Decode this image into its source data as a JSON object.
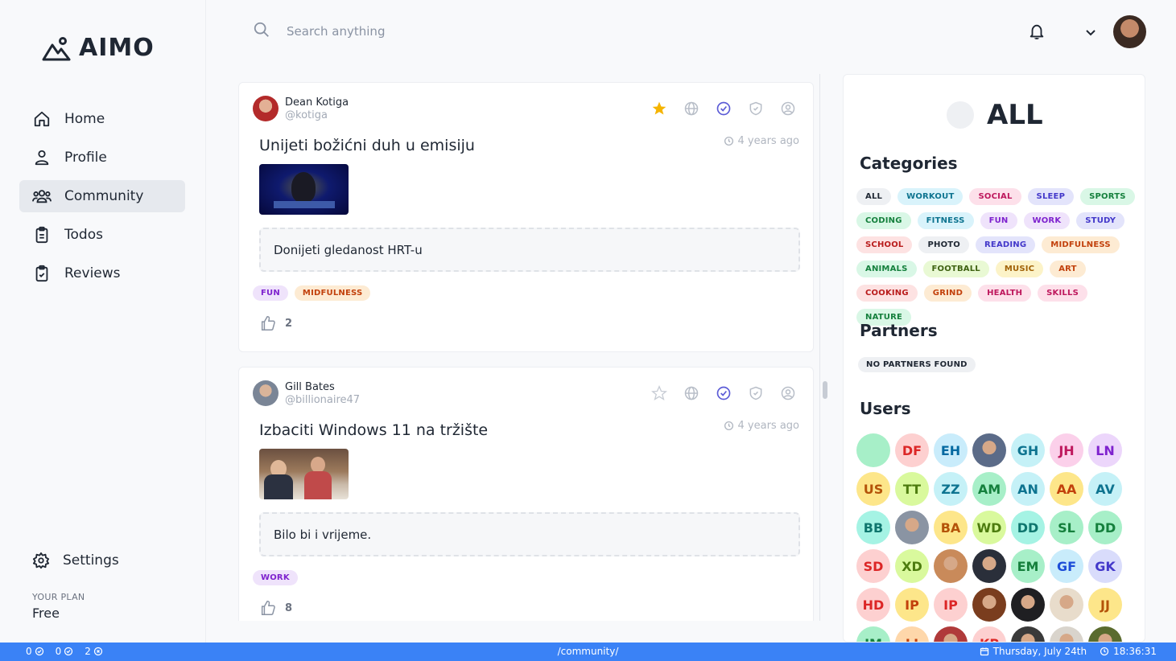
{
  "app": {
    "name": "AIMO"
  },
  "nav": {
    "items": [
      {
        "label": "Home",
        "icon": "home-icon"
      },
      {
        "label": "Profile",
        "icon": "user-icon"
      },
      {
        "label": "Community",
        "icon": "users-icon",
        "active": true
      },
      {
        "label": "Todos",
        "icon": "clipboard-icon"
      },
      {
        "label": "Reviews",
        "icon": "clipboard-check-icon"
      }
    ],
    "settings_label": "Settings",
    "plan_label": "YOUR PLAN",
    "plan_value": "Free"
  },
  "search": {
    "placeholder": "Search anything"
  },
  "posts": [
    {
      "author": "Dean Kotiga",
      "handle": "@kotiga",
      "title": "Unijeti božićni duh u emisiju",
      "time": "4 years ago",
      "description": "Donijeti gledanost HRT-u",
      "tags": [
        "FUN",
        "MIDFULNESS"
      ],
      "likes": "2",
      "starred": true
    },
    {
      "author": "Gill Bates",
      "handle": "@billionaire47",
      "title": "Izbaciti Windows 11 na tržište",
      "time": "4 years ago",
      "description": "Bilo bi i vrijeme.",
      "tags": [
        "WORK"
      ],
      "likes": "8",
      "starred": false
    }
  ],
  "panel": {
    "title": "ALL",
    "categories_title": "Categories",
    "categories": [
      {
        "label": "ALL",
        "bg": "#eef0f3",
        "fg": "#1f2733"
      },
      {
        "label": "WORKOUT",
        "bg": "#d9f3fb",
        "fg": "#0e7490"
      },
      {
        "label": "SOCIAL",
        "bg": "#fde0ea",
        "fg": "#be185d"
      },
      {
        "label": "SLEEP",
        "bg": "#e3e4fb",
        "fg": "#4338ca"
      },
      {
        "label": "SPORTS",
        "bg": "#d9f7e6",
        "fg": "#15803d"
      },
      {
        "label": "CODING",
        "bg": "#d9f7e6",
        "fg": "#15803d"
      },
      {
        "label": "FITNESS",
        "bg": "#d9f3fb",
        "fg": "#0e7490"
      },
      {
        "label": "FUN",
        "bg": "#efe3fb",
        "fg": "#7e22ce"
      },
      {
        "label": "WORK",
        "bg": "#efe3fb",
        "fg": "#7e22ce"
      },
      {
        "label": "STUDY",
        "bg": "#e3e4fb",
        "fg": "#4338ca"
      },
      {
        "label": "SCHOOL",
        "bg": "#fde2e2",
        "fg": "#b91c1c"
      },
      {
        "label": "PHOTO",
        "bg": "#eef0f3",
        "fg": "#1f2733"
      },
      {
        "label": "READING",
        "bg": "#e3e4fb",
        "fg": "#4338ca"
      },
      {
        "label": "MIDFULNESS",
        "bg": "#fdebd3",
        "fg": "#c2410c"
      },
      {
        "label": "ANIMALS",
        "bg": "#d9f7e6",
        "fg": "#15803d"
      },
      {
        "label": "FOOTBALL",
        "bg": "#e9f9d4",
        "fg": "#3f6212"
      },
      {
        "label": "MUSIC",
        "bg": "#fcf3c8",
        "fg": "#a16207"
      },
      {
        "label": "ART",
        "bg": "#fdebd3",
        "fg": "#c2410c"
      },
      {
        "label": "COOKING",
        "bg": "#fde2e2",
        "fg": "#b91c1c"
      },
      {
        "label": "GRIND",
        "bg": "#fdebd3",
        "fg": "#c2410c"
      },
      {
        "label": "HEALTH",
        "bg": "#fde0ea",
        "fg": "#be185d"
      },
      {
        "label": "SKILLS",
        "bg": "#fde0ea",
        "fg": "#be185d"
      },
      {
        "label": "NATURE",
        "bg": "#d9f7e6",
        "fg": "#15803d"
      }
    ],
    "partners_title": "Partners",
    "partners_empty": "NO PARTNERS FOUND",
    "users_title": "Users",
    "users": [
      {
        "initials": "",
        "bg": "#a7efc8",
        "fg": "#15803d"
      },
      {
        "initials": "DF",
        "bg": "#fdd0d0",
        "fg": "#dc2626"
      },
      {
        "initials": "EH",
        "bg": "#c9ecfb",
        "fg": "#0369a1"
      },
      {
        "initials": "",
        "bg": "#5b6b88",
        "fg": "#fff",
        "photo": true
      },
      {
        "initials": "GH",
        "bg": "#c5f1f7",
        "fg": "#0e7490"
      },
      {
        "initials": "JH",
        "bg": "#fbd0ea",
        "fg": "#be185d"
      },
      {
        "initials": "LN",
        "bg": "#ecd6fb",
        "fg": "#7e22ce"
      },
      {
        "initials": "US",
        "bg": "#fde68a",
        "fg": "#b45309"
      },
      {
        "initials": "TT",
        "bg": "#d9f99d",
        "fg": "#4d7c0f"
      },
      {
        "initials": "ZZ",
        "bg": "#c5f1f7",
        "fg": "#0e7490"
      },
      {
        "initials": "AM",
        "bg": "#a7efc8",
        "fg": "#15803d"
      },
      {
        "initials": "AN",
        "bg": "#c5f1f7",
        "fg": "#0e7490"
      },
      {
        "initials": "AA",
        "bg": "#fde68a",
        "fg": "#c2410c"
      },
      {
        "initials": "AV",
        "bg": "#c5f1f7",
        "fg": "#0e7490"
      },
      {
        "initials": "BB",
        "bg": "#a5f3e4",
        "fg": "#0f766e"
      },
      {
        "initials": "",
        "bg": "#8a94a3",
        "fg": "#fff",
        "photo": true
      },
      {
        "initials": "BA",
        "bg": "#fde68a",
        "fg": "#b45309"
      },
      {
        "initials": "WD",
        "bg": "#d9f99d",
        "fg": "#4d7c0f"
      },
      {
        "initials": "DD",
        "bg": "#a5f3e4",
        "fg": "#0f766e"
      },
      {
        "initials": "SL",
        "bg": "#a7efc8",
        "fg": "#15803d"
      },
      {
        "initials": "DD",
        "bg": "#a7efc8",
        "fg": "#15803d"
      },
      {
        "initials": "SD",
        "bg": "#fdd0d0",
        "fg": "#dc2626"
      },
      {
        "initials": "XD",
        "bg": "#d9f99d",
        "fg": "#4d7c0f"
      },
      {
        "initials": "",
        "bg": "#c98a5a",
        "fg": "#fff",
        "photo": true
      },
      {
        "initials": "",
        "bg": "#2a2f3a",
        "fg": "#fff",
        "photo": true
      },
      {
        "initials": "EM",
        "bg": "#a7efc8",
        "fg": "#15803d"
      },
      {
        "initials": "GF",
        "bg": "#c9ecfb",
        "fg": "#1d4ed8"
      },
      {
        "initials": "GK",
        "bg": "#d9dcfb",
        "fg": "#4338ca"
      },
      {
        "initials": "HD",
        "bg": "#fdd0d0",
        "fg": "#dc2626"
      },
      {
        "initials": "IP",
        "bg": "#fde68a",
        "fg": "#c2410c"
      },
      {
        "initials": "IP",
        "bg": "#fdd0d0",
        "fg": "#dc2626"
      },
      {
        "initials": "",
        "bg": "#7a3d1e",
        "fg": "#fff",
        "photo": true
      },
      {
        "initials": "",
        "bg": "#1f1f22",
        "fg": "#fff",
        "photo": true
      },
      {
        "initials": "",
        "bg": "#e8dccb",
        "fg": "#fff",
        "photo": true
      },
      {
        "initials": "JJ",
        "bg": "#fde68a",
        "fg": "#b45309"
      },
      {
        "initials": "JM",
        "bg": "#a7efc8",
        "fg": "#15803d"
      },
      {
        "initials": "LJ",
        "bg": "#fed7aa",
        "fg": "#c2410c"
      },
      {
        "initials": "",
        "bg": "#b03a3a",
        "fg": "#fff",
        "photo": true
      },
      {
        "initials": "KP",
        "bg": "#fdd0d0",
        "fg": "#dc2626"
      },
      {
        "initials": "",
        "bg": "#3a3a3a",
        "fg": "#fff",
        "photo": true
      },
      {
        "initials": "",
        "bg": "#d9d4cc",
        "fg": "#fff",
        "photo": true
      },
      {
        "initials": "",
        "bg": "#5a6b2e",
        "fg": "#fff",
        "photo": true
      }
    ]
  },
  "statusbar": {
    "counters": [
      "0",
      "0",
      "2"
    ],
    "path": "/community/",
    "date": "Thursday, July 24th",
    "time": "18:36:31"
  },
  "colors": {
    "accent": "#3a82f6",
    "star": "#f5b400",
    "check": "#5b5bd6"
  }
}
